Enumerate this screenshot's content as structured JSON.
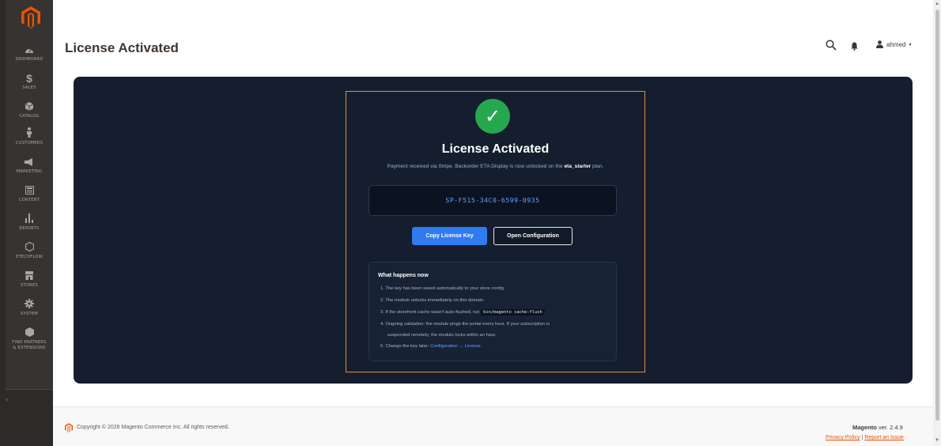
{
  "sidebar": {
    "items": [
      {
        "label": "DASHBOARD",
        "icon": "dashboard-icon"
      },
      {
        "label": "SALES",
        "icon": "dollar-icon"
      },
      {
        "label": "CATALOG",
        "icon": "cube-icon"
      },
      {
        "label": "CUSTOMERS",
        "icon": "person-icon"
      },
      {
        "label": "MARKETING",
        "icon": "megaphone-icon"
      },
      {
        "label": "CONTENT",
        "icon": "layout-icon"
      },
      {
        "label": "REPORTS",
        "icon": "bar-chart-icon"
      },
      {
        "label": "ETECHFLOW",
        "icon": "hexagon-icon"
      },
      {
        "label": "STORES",
        "icon": "store-icon"
      },
      {
        "label": "SYSTEM",
        "icon": "gear-icon"
      },
      {
        "label": "FIND PARTNERS",
        "label2": "& EXTENSIONS",
        "icon": "partners-icon"
      }
    ]
  },
  "header": {
    "title": "License Activated",
    "user": "ahmed"
  },
  "card": {
    "title": "License Activated",
    "subtitle_pre": "Payment received via Stripe. Backorder ETA Display is now unlocked on the ",
    "subtitle_plan": "eta_starter",
    "subtitle_post": " plan.",
    "license_key": "SP-F515-34C0-6599-0935",
    "copy_button": "Copy License Key",
    "config_button": "Open Configuration"
  },
  "info": {
    "title": "What happens now",
    "item1": "1. The key has been saved automatically to your store config.",
    "item2": "2. The module unlocks immediately on this domain.",
    "item3_pre": "3. If the storefront cache wasn't auto-flushed, run",
    "item3_code": "bin/magento cache:flush",
    "item3_post": ".",
    "item4a": "4. Ongoing validation: the module pings the portal every hour. If your subscription is",
    "item4b": "suspended remotely, the module locks within an hour.",
    "item5_pre": "5. Change the key later: ",
    "item5_link": "Configuration → License",
    "item5_post": "."
  },
  "footer": {
    "copyright": "Copyright © 2026 Magento Commerce Inc. All rights reserved.",
    "brand": "Magento",
    "version": " ver. 2.4.9",
    "privacy": "Privacy Policy",
    "separator": "|",
    "report": "Report an Issue"
  },
  "colors": {
    "sidebar": "#373330",
    "panel": "#141e2e",
    "accent_orange": "#e0913c",
    "success_green": "#25a84f",
    "primary_blue": "#2f7bf0",
    "magento_orange": "#eb5202"
  }
}
